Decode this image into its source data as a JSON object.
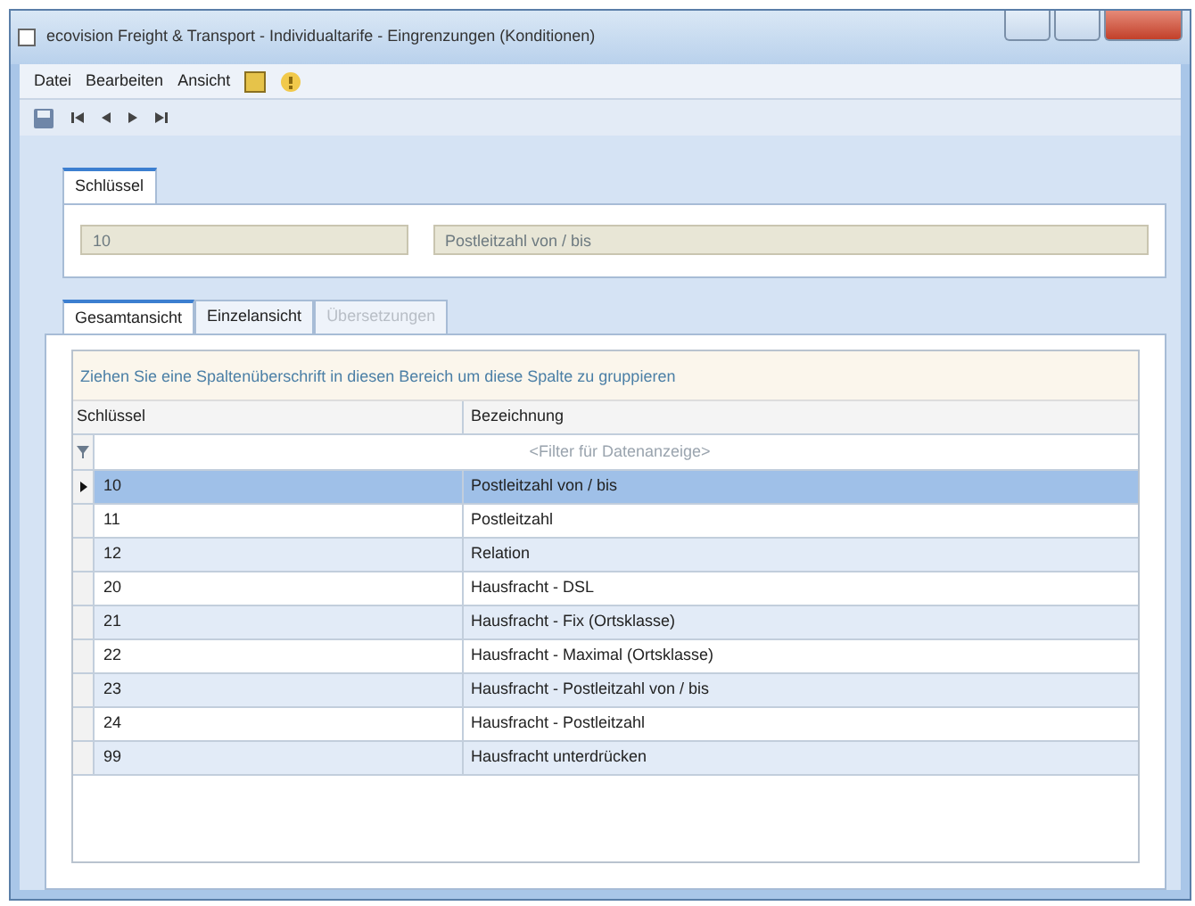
{
  "window": {
    "title": "ecovision Freight & Transport - Individualtarife - Eingrenzungen (Konditionen)"
  },
  "menu": [
    "Datei",
    "Bearbeiten",
    "Ansicht"
  ],
  "key_tab": {
    "label": "Schlüssel",
    "selected": true
  },
  "key_fields": [
    {
      "value": "10"
    },
    {
      "value": "Postleitzahl von / bis"
    }
  ],
  "tabs": [
    {
      "label": "Gesamtansicht",
      "selected": true,
      "disabled": false
    },
    {
      "label": "Einzelansicht",
      "selected": false,
      "disabled": false
    },
    {
      "label": "Übersetzungen",
      "selected": false,
      "disabled": true
    }
  ],
  "group_hint": "Ziehen Sie eine Spaltenüberschrift in diesen Bereich um diese Spalte zu gruppieren",
  "table": {
    "columns": [
      "Schlüssel",
      "Bezeichnung"
    ],
    "filter_placeholder": "<Filter für Datenanzeige>",
    "rows": [
      {
        "cells": [
          "10",
          "Postleitzahl von / bis"
        ],
        "selected": true
      },
      {
        "cells": [
          "11",
          "Postleitzahl"
        ],
        "selected": false
      },
      {
        "cells": [
          "12",
          "Relation"
        ],
        "selected": false
      },
      {
        "cells": [
          "20",
          "Hausfracht - DSL"
        ],
        "selected": false
      },
      {
        "cells": [
          "21",
          "Hausfracht - Fix   (Ortsklasse)"
        ],
        "selected": false
      },
      {
        "cells": [
          "22",
          "Hausfracht - Maximal   (Ortsklasse)"
        ],
        "selected": false
      },
      {
        "cells": [
          "23",
          "Hausfracht - Postleitzahl von / bis"
        ],
        "selected": false
      },
      {
        "cells": [
          "24",
          "Hausfracht - Postleitzahl"
        ],
        "selected": false
      },
      {
        "cells": [
          "99",
          "Hausfracht unterdrücken"
        ],
        "selected": false
      }
    ]
  }
}
